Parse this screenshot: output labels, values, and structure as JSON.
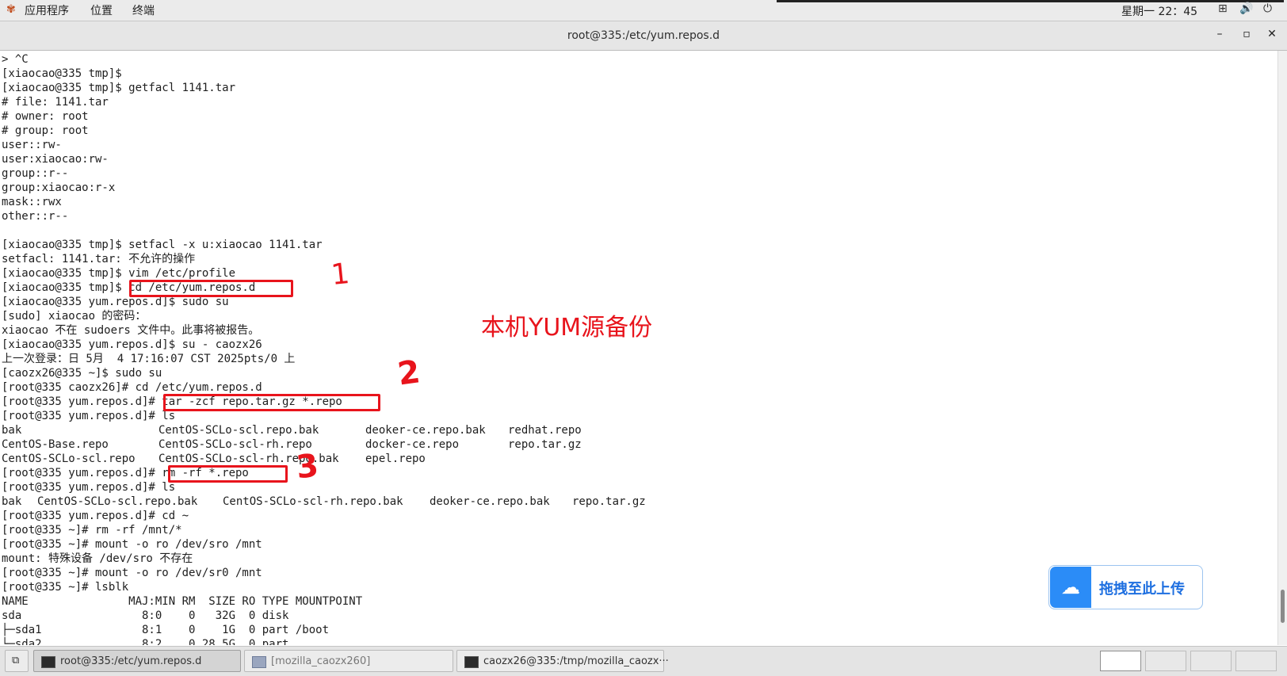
{
  "topbar": {
    "apps_label": "应用程序",
    "places_label": "位置",
    "terminal_label": "终端",
    "clock": "星期一 22：45"
  },
  "window": {
    "title": "root@335:/etc/yum.repos.d",
    "minimize": "–",
    "maximize": "▫",
    "close": "✕"
  },
  "terminal": {
    "lines": [
      "> ^C",
      "[xiaocao@335 tmp]$",
      "[xiaocao@335 tmp]$ getfacl 1141.tar",
      "# file: 1141.tar",
      "# owner: root",
      "# group: root",
      "user::rw-",
      "user:xiaocao:rw-",
      "group::r--",
      "group:xiaocao:r-x",
      "mask::rwx",
      "other::r--",
      "",
      "[xiaocao@335 tmp]$ setfacl -x u:xiaocao 1141.tar",
      "setfacl: 1141.tar: 不允许的操作",
      "[xiaocao@335 tmp]$ vim /etc/profile",
      "[xiaocao@335 tmp]$ cd /etc/yum.repos.d",
      "[xiaocao@335 yum.repos.d]$ sudo su",
      "[sudo] xiaocao 的密码：",
      "xiaocao 不在 sudoers 文件中。此事将被报告。",
      "[xiaocao@335 yum.repos.d]$ su - caozx26",
      "上一次登录：日 5月  4 17:16:07 CST 2025pts/0 上",
      "[caozx26@335 ~]$ sudo su",
      "[root@335 caozx26]# cd /etc/yum.repos.d",
      "[root@335 yum.repos.d]# tar -zcf repo.tar.gz *.repo",
      "[root@335 yum.repos.d]# ls"
    ],
    "ls1": {
      "row1": [
        "bak",
        "CentOS-SCLo-scl.repo.bak",
        "deoker-ce.repo.bak",
        "redhat.repo"
      ],
      "row2": [
        "CentOS-Base.repo",
        "CentOS-SCLo-scl-rh.repo",
        "docker-ce.repo",
        "repo.tar.gz"
      ],
      "row3": [
        "CentOS-SCLo-scl.repo",
        "CentOS-SCLo-scl-rh.repo.bak",
        "epel.repo"
      ]
    },
    "lines2": [
      "[root@335 yum.repos.d]# rm -rf *.repo",
      "[root@335 yum.repos.d]# ls"
    ],
    "ls2": [
      "bak",
      "CentOS-SCLo-scl.repo.bak",
      "CentOS-SCLo-scl-rh.repo.bak",
      "deoker-ce.repo.bak",
      "repo.tar.gz"
    ],
    "lines3": [
      "[root@335 yum.repos.d]# cd ~",
      "[root@335 ~]# rm -rf /mnt/*",
      "[root@335 ~]# mount -o ro /dev/sro /mnt",
      "mount: 特殊设备 /dev/sro 不存在",
      "[root@335 ~]# mount -o ro /dev/sr0 /mnt",
      "[root@335 ~]# lsblk",
      "NAME               MAJ:MIN RM  SIZE RO TYPE MOUNTPOINT",
      "sda                  8:0    0   32G  0 disk",
      "├─sda1               8:1    0    1G  0 part /boot",
      "└─sda2               8:2    0 28.5G  0 part"
    ]
  },
  "annotations": {
    "mark1": "1",
    "mark2": "2",
    "mark3": "3",
    "caption": "本机YUM源备份"
  },
  "upload_widget": {
    "label": "拖拽至此上传"
  },
  "taskbar": {
    "tasks": [
      "root@335:/etc/yum.repos.d",
      "[mozilla_caozx260]",
      "caozx26@335:/tmp/mozilla_caozx···"
    ]
  },
  "colors": {
    "directory": "#1d54d6",
    "archive": "#d22a2a",
    "annotation": "#e8141c"
  }
}
